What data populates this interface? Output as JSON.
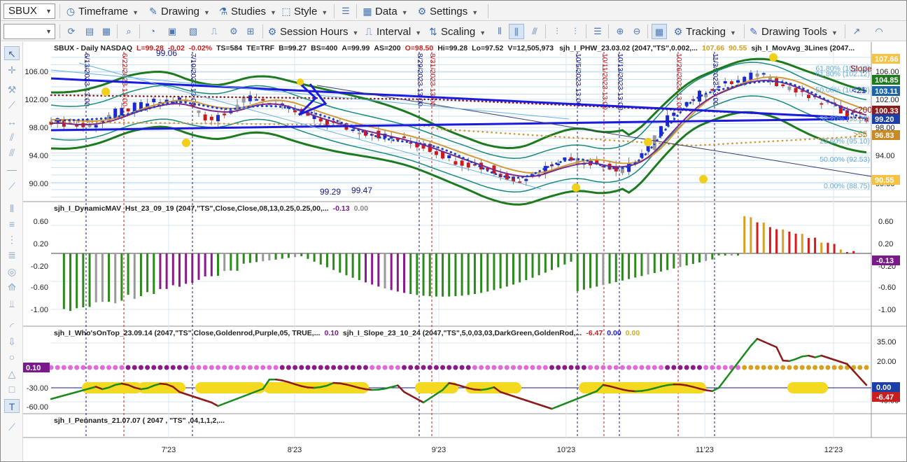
{
  "symbol_combo": "SBUX",
  "toolbar1": [
    {
      "label": "Timeframe",
      "icon": "clock-icon"
    },
    {
      "label": "Drawing",
      "icon": "pencil-icon"
    },
    {
      "label": "Studies",
      "icon": "flask-icon"
    },
    {
      "label": "Style",
      "icon": "style-icon"
    },
    {
      "label": "Data",
      "icon": "data-icon"
    },
    {
      "label": "Settings",
      "icon": "gear-icon"
    }
  ],
  "toolbar2": [
    {
      "label": "Session Hours",
      "icon": "gear-icon"
    },
    {
      "label": "Interval",
      "icon": "interval-icon"
    },
    {
      "label": "Scaling",
      "icon": "scaling-icon"
    },
    {
      "label": "Tracking",
      "icon": "gear-icon"
    },
    {
      "label": "Drawing Tools",
      "icon": "pencil-icon"
    }
  ],
  "price_header": {
    "title": "SBUX - Daily  NASDAQ",
    "L": "L=99.28",
    "chg": "-0.02",
    "pct": "-0.02%",
    "ts": "TS=584",
    "te": "TE=TRF",
    "B": "B=99.27",
    "BS": "BS=400",
    "A": "A=99.99",
    "AS": "AS=200",
    "O": "O=98.50",
    "Hi": "Hi=99.28",
    "Lo": "Lo=97.52",
    "V": "V=12,505,973",
    "study1": "sjh_I_PHW_23.03.02 (2047,\"TS\",0.002,...",
    "v1": "107.66",
    "v2": "90.55",
    "study2": "sjh_I_MovAvg_3Lines (2047..."
  },
  "price_axis": [
    "106.00",
    "102.00",
    "98.00",
    "94.00",
    "90.00"
  ],
  "price_right_axis": [
    "106.00",
    "102.00",
    "98.00",
    "94.00",
    "90.00"
  ],
  "price_badges": [
    {
      "text": "107.66",
      "color": "#f5c242"
    },
    {
      "text": "104.85",
      "color": "#1d7a1d"
    },
    {
      "text": "103.11",
      "color": "#1a66a8"
    },
    {
      "text": "100.33",
      "color": "#8b1a1a"
    },
    {
      "text": "99.20",
      "color": "#1a3fa8"
    },
    {
      "text": "96.83",
      "color": "#c98a24"
    },
    {
      "text": "90.55",
      "color": "#f5c242"
    }
  ],
  "price_labels": {
    "slope": "Slope",
    "l21": "<21",
    "l200": "<200",
    "l55": ">55",
    "v9906": "99.06",
    "v9929": "99.29",
    "v9947": "99.47"
  },
  "fib": [
    "61.80% (102.12)",
    "61.80% (102.12)",
    "50.00% (101.23)",
    "38.20% (98.35)",
    "23.60% (95.10)",
    "50.00% (92.53)",
    "0.00% (88.75)"
  ],
  "vdates": [
    {
      "text": "6/13/2023 13:00",
      "color": "#1a1a8c"
    },
    {
      "text": "6/22/2023 13:00",
      "color": "#c81e1e"
    },
    {
      "text": "7/10/2023 13:00",
      "color": "#1a1a8c"
    },
    {
      "text": "8/29/2023 13:00",
      "color": "#1a1a8c"
    },
    {
      "text": "8/31/2023 13:00",
      "color": "#c81e1e"
    },
    {
      "text": "10/5/2023 13:00",
      "color": "#1a1a8c"
    },
    {
      "text": "10/11/2023 13:00",
      "color": "#c81e1e"
    },
    {
      "text": "10/13/2023 13:00",
      "color": "#1a1a8c"
    },
    {
      "text": "10/26/2023 13:00",
      "color": "#c81e1e"
    },
    {
      "text": "11/3/2023 13:00",
      "color": "#1a1a8c"
    }
  ],
  "hist_header": {
    "name": "sjh_I_DynamicMAV_Hst_23_09_19 (2047,\"TS\",Close,Close,08,13,0.25,0.25,00,...",
    "v1": "-0.13",
    "v2": "0.00"
  },
  "hist_axis": [
    "0.60",
    "0.20",
    "-0.20",
    "-0.60",
    "-1.00"
  ],
  "hist_badge": "-0.13",
  "osc_header": {
    "name1": "sjh_I_Who'sOnTop_23.09.14 (2047,\"TS\",Close,Goldenrod,Purple,05,  TRUE,...",
    "v1": "0.10",
    "name2": "sjh_I_Slope_23_10_24 (2047,\"TS\",5,0,03,03,DarkGreen,GoldenRod,...",
    "v2": "-6.47",
    "v3": "0.00",
    "v4": "0.00"
  },
  "osc_left_axis": [
    "0.10",
    "-30.00",
    "-60.00"
  ],
  "osc_right_axis": [
    "35.00",
    "20.00",
    "-25.00",
    "-40.00"
  ],
  "osc_badges": [
    {
      "text": "0.00",
      "color": "#1a3fa8"
    },
    {
      "text": "-6.47",
      "color": "#c81e1e"
    }
  ],
  "pennant_header": "sjh_I_Pennants_21.07.07 (  2047 ,  \"TS\" ,04,1,1,2,...",
  "x_axis": [
    "7'23",
    "8'23",
    "9'23",
    "10'23",
    "11'23",
    "12'23"
  ]
}
